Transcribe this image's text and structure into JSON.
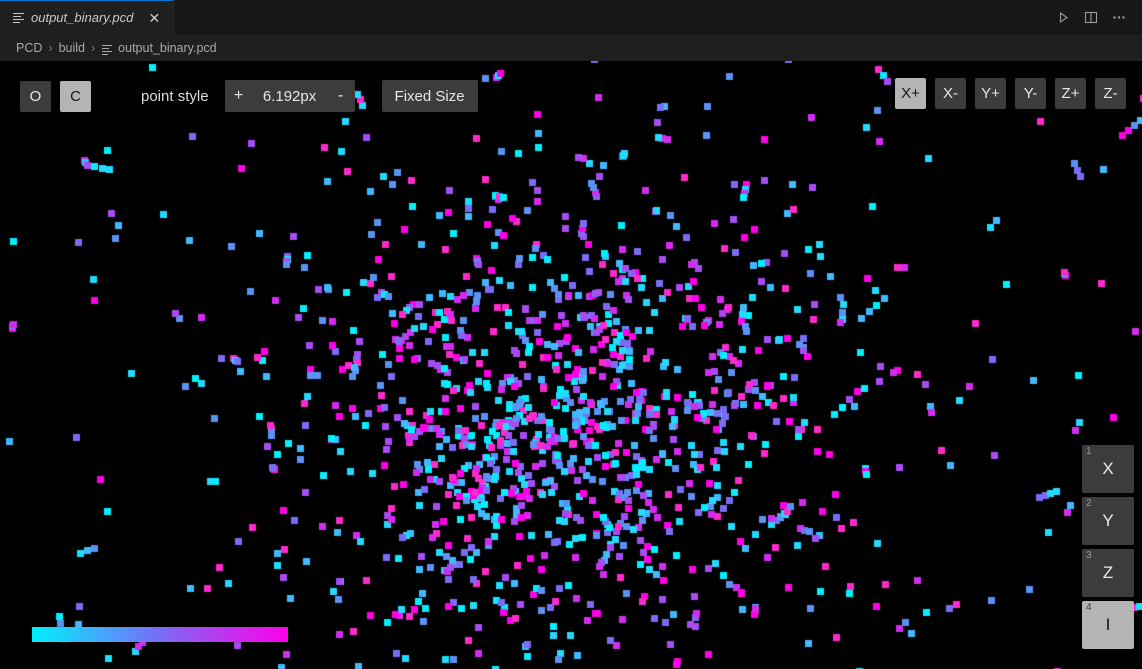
{
  "window": {
    "tab": {
      "label": "output_binary.pcd",
      "icon": "pcd-file-icon",
      "close_label": "✕"
    },
    "actions": [
      {
        "name": "run-preview-icon",
        "label": "▷"
      },
      {
        "name": "split-editor-icon",
        "label": "▫"
      },
      {
        "name": "more-actions-icon",
        "label": "…"
      }
    ]
  },
  "breadcrumb": {
    "items": [
      "PCD",
      "build",
      "output_binary.pcd"
    ],
    "separator": "›",
    "file_icon": "pcd-file-icon"
  },
  "toolbar": {
    "orbit_label": "O",
    "camera_label": "C",
    "active_camera_mode": "C",
    "point_style_label": "point style",
    "point_size_increase": "+",
    "point_size_value": "6.192px",
    "point_size_decrease": "-",
    "fixed_size_label": "Fixed Size",
    "axis_buttons": [
      "X+",
      "X-",
      "Y+",
      "Y-",
      "Z+",
      "Z-"
    ],
    "active_axis": "X+"
  },
  "field_panel": {
    "items": [
      {
        "num": "1",
        "label": "X"
      },
      {
        "num": "2",
        "label": "Y"
      },
      {
        "num": "3",
        "label": "Z"
      },
      {
        "num": "4",
        "label": "I"
      }
    ],
    "active_label": "I"
  },
  "colorbar": {
    "name": "intensity-colorbar",
    "start_color": "#00F0FF",
    "mid_color": "#7B6CF6",
    "end_color": "#FF00E8"
  },
  "viewer": {
    "background": "#000000",
    "point_count": 1180,
    "point_size": 7,
    "palette": [
      "#00F0FF",
      "#22D9FF",
      "#3FB9FF",
      "#5A92F5",
      "#7B6CF6",
      "#A74BF2",
      "#D42BF0",
      "#FF00E8",
      "#FF2ACB"
    ]
  }
}
